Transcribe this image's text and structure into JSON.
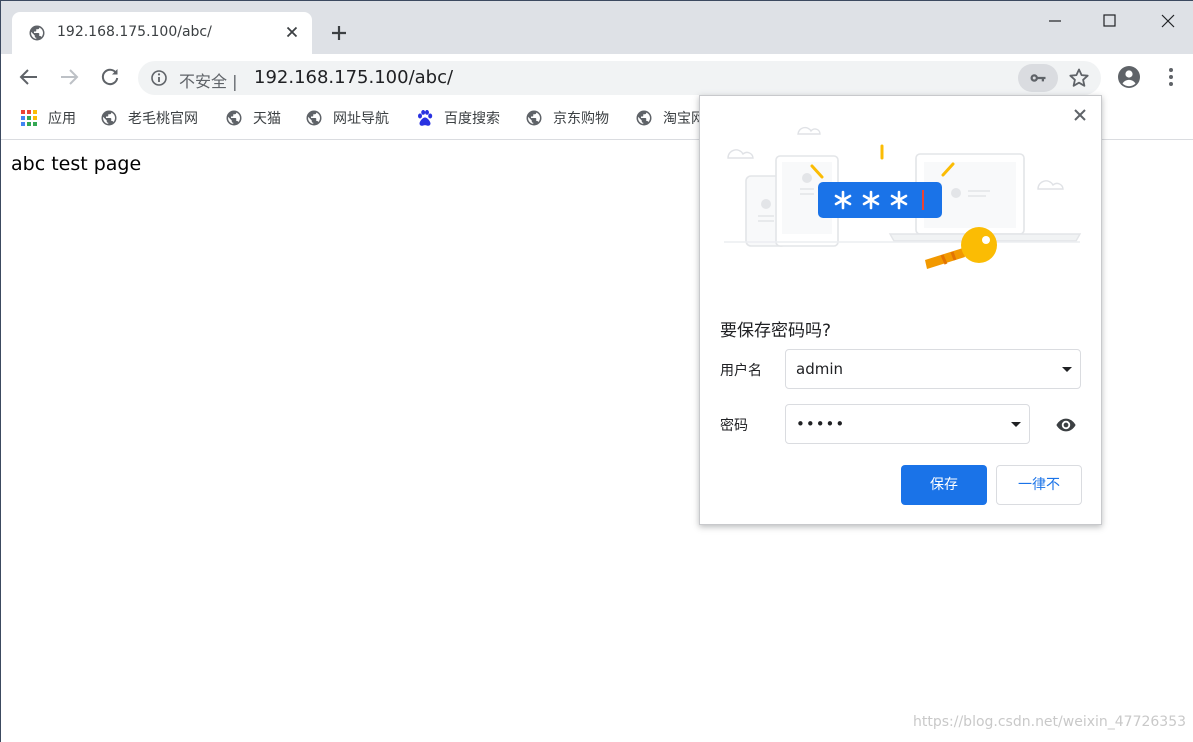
{
  "tab": {
    "title": "192.168.175.100/abc/"
  },
  "omnibox": {
    "security_label": "不安全",
    "separator": "|",
    "url": "192.168.175.100/abc/"
  },
  "bookmarks": [
    {
      "label": "应用",
      "icon": "apps-grid-icon"
    },
    {
      "label": "老毛桃官网",
      "icon": "globe-icon"
    },
    {
      "label": "天猫",
      "icon": "globe-icon"
    },
    {
      "label": "网址导航",
      "icon": "globe-icon"
    },
    {
      "label": "百度搜索",
      "icon": "baidu-paw-icon"
    },
    {
      "label": "京东购物",
      "icon": "globe-icon"
    },
    {
      "label": "淘宝网",
      "icon": "globe-icon"
    }
  ],
  "page": {
    "body_text": "abc test page"
  },
  "save_password_bubble": {
    "heading": "要保存密码吗?",
    "username_label": "用户名",
    "username_value": "admin",
    "password_label": "密码",
    "password_value": "•••••",
    "save_button": "保存",
    "never_button": "一律不"
  },
  "watermark": "https://blog.csdn.net/weixin_47726353",
  "colors": {
    "accent": "#1a73e8",
    "tabstrip": "#dee1e6",
    "omnibox": "#f1f3f4",
    "key_yellow": "#fbbc04"
  }
}
